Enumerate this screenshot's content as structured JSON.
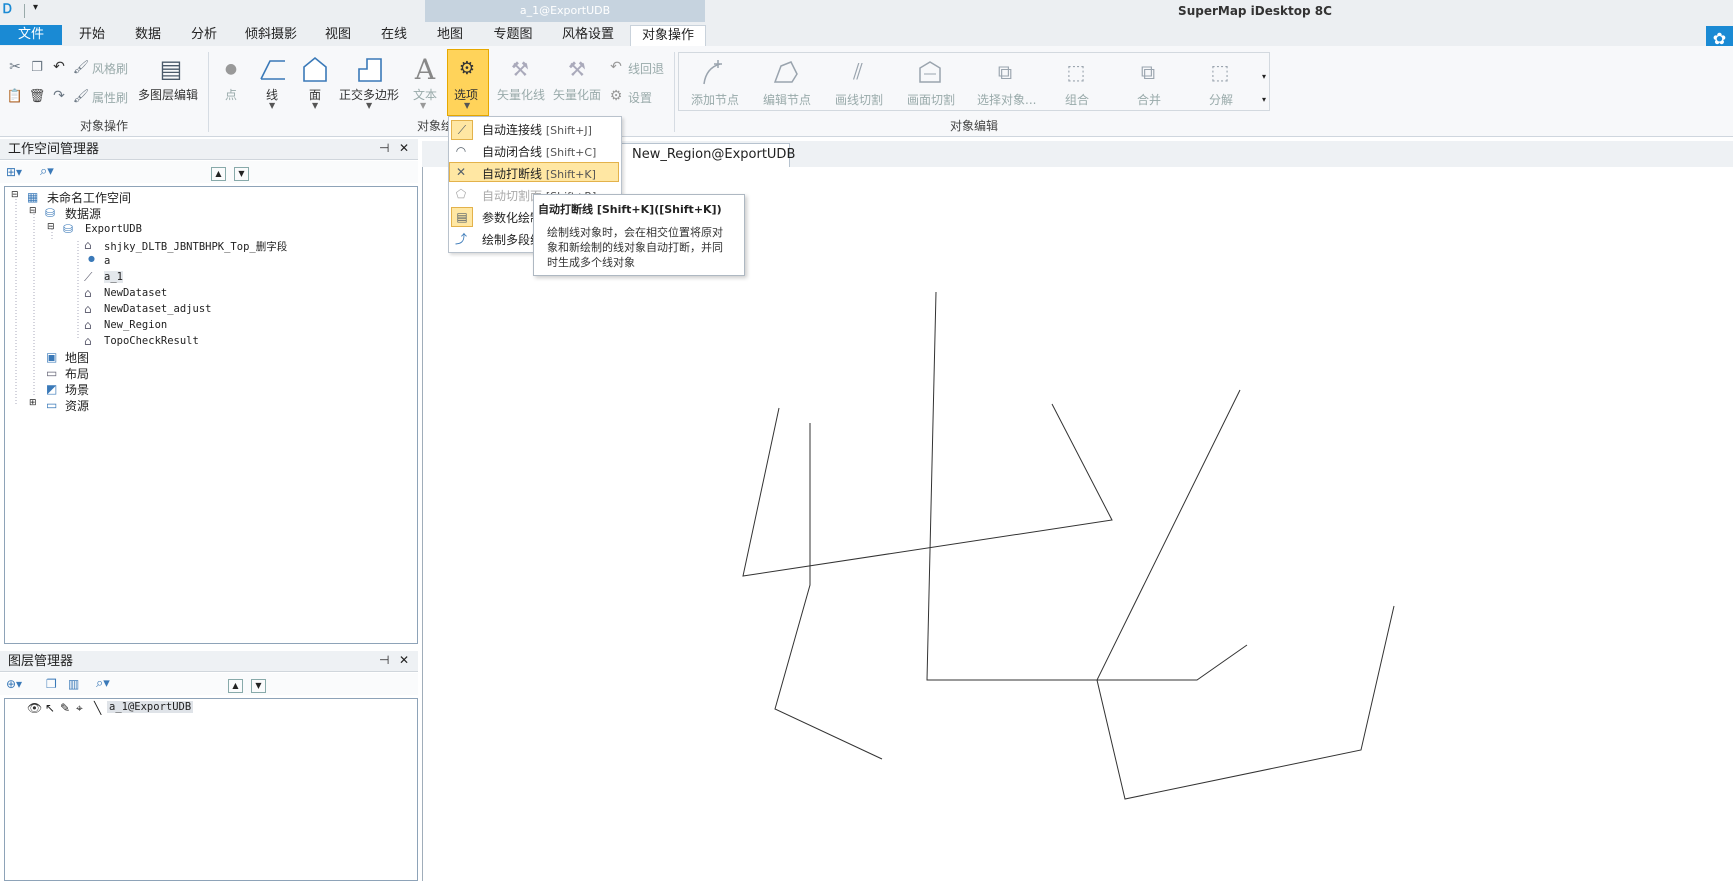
{
  "titlebar": {
    "app_title": "SuperMap iDesktop 8C",
    "doc_title": "a_1@ExportUDB"
  },
  "tabs": [
    "文件",
    "开始",
    "数据",
    "分析",
    "倾斜摄影",
    "视图",
    "在线",
    "地图",
    "专题图",
    "风格设置",
    "对象操作"
  ],
  "ribbon": {
    "cut": "风格刷",
    "paste_props": "属性刷",
    "multi_layer_edit": "多图层编辑",
    "point": "点",
    "line": "线",
    "region": "面",
    "ortho_polygon": "正交多边形",
    "text": "文本",
    "options": "选项",
    "vectorize_line": "矢量化线",
    "vectorize_region": "矢量化面",
    "line_retreat": "线回退",
    "settings": "设置",
    "add_node": "添加节点",
    "edit_node": "编辑节点",
    "draw_line_split": "画线切割",
    "draw_region_split": "画面切割",
    "select_object": "选择对象...",
    "combine": "组合",
    "merge": "合并",
    "decompose": "分解",
    "group_object_op": "对象操作",
    "group_object_draw": "对象绘制",
    "group_object_edit": "对象编辑"
  },
  "options_menu": {
    "items": [
      {
        "label": "自动连接线",
        "shortcut": "[Shift+J]"
      },
      {
        "label": "自动闭合线",
        "shortcut": "[Shift+C]"
      },
      {
        "label": "自动打断线",
        "shortcut": "[Shift+K]"
      },
      {
        "label": "自动切割面",
        "shortcut": "[Shift+R]"
      },
      {
        "label": "参数化绘制",
        "shortcut": ""
      },
      {
        "label": "绘制多段线",
        "shortcut": ""
      }
    ]
  },
  "tooltip": {
    "title": "自动打断线 [Shift+K]([Shift+K])",
    "body": "绘制线对象时，会在相交位置将原对象和新绘制的线对象自动打断，并同时生成多个线对象"
  },
  "workspace_manager": {
    "title": "工作空间管理器",
    "tree": {
      "workspace": "未命名工作空间",
      "datasources": "数据源",
      "udb": "ExportUDB",
      "datasets": [
        "shjky_DLTB_JBNTBHPK_Top_删字段",
        "a",
        "a_1",
        "NewDataset",
        "NewDataset_adjust",
        "New_Region",
        "TopoCheckResult"
      ],
      "maps": "地图",
      "layouts": "布局",
      "scenes": "场景",
      "resources": "资源"
    }
  },
  "layer_manager": {
    "title": "图层管理器",
    "layer": "a_1@ExportUDB"
  },
  "map_tab": {
    "label": "New_Region@ExportUDB"
  },
  "colors": {
    "accent": "#1a8ad4",
    "highlight": "#ffd35a"
  }
}
